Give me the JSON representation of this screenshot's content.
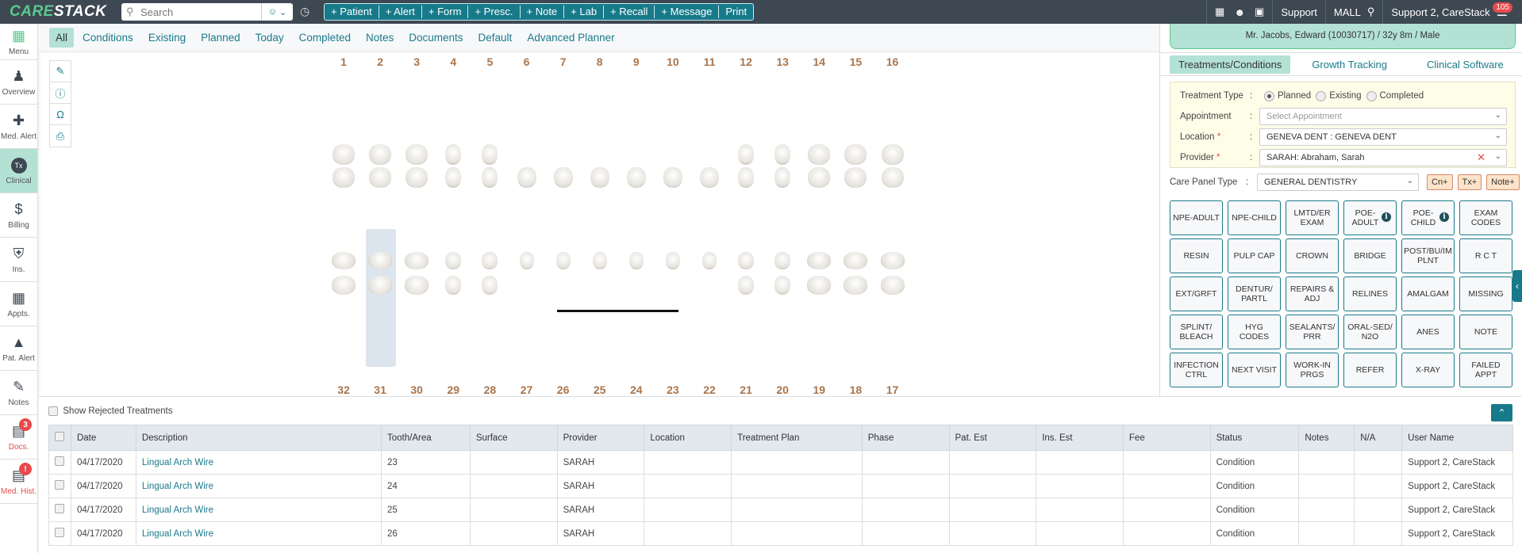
{
  "app": {
    "logo_left": "CAR",
    "logo_e": "E",
    "logo_right": "STACK"
  },
  "search": {
    "placeholder": "Search"
  },
  "quick_actions": [
    "+ Patient",
    "+ Alert",
    "+ Form",
    "+ Presc.",
    "+ Note",
    "+ Lab",
    "+ Recall",
    "+ Message",
    "Print"
  ],
  "top_right": {
    "support": "Support",
    "location": "MALL",
    "user": "Support 2, CareStack",
    "notification_count": "105"
  },
  "sidebar": {
    "items": [
      {
        "label": "Menu",
        "icon": "grid-icon"
      },
      {
        "label": "Overview",
        "icon": "person-icon"
      },
      {
        "label": "Med. Alert",
        "icon": "plus-icon"
      },
      {
        "label": "Clinical",
        "icon": "tx-icon",
        "active": true
      },
      {
        "label": "Billing",
        "icon": "dollar-doc-icon"
      },
      {
        "label": "Ins.",
        "icon": "shield-icon"
      },
      {
        "label": "Appts.",
        "icon": "calendar-icon"
      },
      {
        "label": "Pat. Alert",
        "icon": "alert-triangle-icon"
      },
      {
        "label": "Notes",
        "icon": "edit-note-icon"
      },
      {
        "label": "Docs.",
        "icon": "docs-icon",
        "badge": "3"
      },
      {
        "label": "Med. Hist.",
        "icon": "med-hist-icon",
        "badge": "!"
      }
    ]
  },
  "filters": [
    "All",
    "Conditions",
    "Existing",
    "Planned",
    "Today",
    "Completed",
    "Notes",
    "Documents",
    "Default",
    "Advanced Planner"
  ],
  "filters_active": "All",
  "tools": [
    "pencil-icon",
    "info-icon",
    "tooth-icon",
    "printer-icon"
  ],
  "chart": {
    "upper_numbers": [
      "1",
      "2",
      "3",
      "4",
      "5",
      "6",
      "7",
      "8",
      "9",
      "10",
      "11",
      "12",
      "13",
      "14",
      "15",
      "16"
    ],
    "lower_numbers": [
      "32",
      "31",
      "30",
      "29",
      "28",
      "27",
      "26",
      "25",
      "24",
      "23",
      "22",
      "21",
      "20",
      "19",
      "18",
      "17"
    ],
    "selected_tooth": "31",
    "lingual_arch_wire_teeth": [
      "26",
      "25",
      "24",
      "23"
    ]
  },
  "patient": {
    "info": "Mr. Jacobs, Edward (10030717) / 32y 8m / Male"
  },
  "right_tabs": [
    "Treatments/Conditions",
    "Growth Tracking",
    "Clinical Software"
  ],
  "form": {
    "treatment_type_label": "Treatment Type",
    "treatment_types": [
      "Planned",
      "Existing",
      "Completed"
    ],
    "treatment_type_selected": "Planned",
    "appointment_label": "Appointment",
    "appointment_placeholder": "Select Appointment",
    "location_label": "Location",
    "location_value": "GENEVA DENT : GENEVA DENT",
    "provider_label": "Provider",
    "provider_value": "SARAH: Abraham, Sarah",
    "care_panel_label": "Care Panel Type",
    "care_panel_value": "GENERAL DENTISTRY",
    "cn_btn": "Cn+",
    "tx_btn": "Tx+",
    "note_btn": "Note+"
  },
  "care_buttons": [
    {
      "label": "NPE-ADULT"
    },
    {
      "label": "NPE-CHILD"
    },
    {
      "label": "LMTD/ER EXAM"
    },
    {
      "label": "POE-ADULT",
      "info": true
    },
    {
      "label": "POE-CHILD",
      "info": true
    },
    {
      "label": "EXAM CODES"
    },
    {
      "label": "RESIN"
    },
    {
      "label": "PULP CAP"
    },
    {
      "label": "CROWN"
    },
    {
      "label": "BRIDGE"
    },
    {
      "label": "POST/BU/IM PLNT"
    },
    {
      "label": "R C T"
    },
    {
      "label": "EXT/GRFT"
    },
    {
      "label": "DENTUR/ PARTL"
    },
    {
      "label": "REPAIRS & ADJ"
    },
    {
      "label": "RELINES"
    },
    {
      "label": "AMALGAM"
    },
    {
      "label": "MISSING"
    },
    {
      "label": "SPLINT/ BLEACH"
    },
    {
      "label": "HYG CODES"
    },
    {
      "label": "SEALANTS/ PRR"
    },
    {
      "label": "ORAL-SED/ N2O"
    },
    {
      "label": "ANES"
    },
    {
      "label": "NOTE"
    },
    {
      "label": "INFECTION CTRL"
    },
    {
      "label": "NEXT VISIT"
    },
    {
      "label": "WORK-IN PRGS"
    },
    {
      "label": "REFER"
    },
    {
      "label": "X-RAY"
    },
    {
      "label": "FAILED APPT"
    }
  ],
  "bottom": {
    "show_rejected": "Show Rejected Treatments",
    "columns": [
      "Date",
      "Description",
      "Tooth/Area",
      "Surface",
      "Provider",
      "Location",
      "Treatment Plan",
      "Phase",
      "Pat. Est",
      "Ins. Est",
      "Fee",
      "Status",
      "Notes",
      "N/A",
      "User Name"
    ],
    "rows": [
      [
        "04/17/2020",
        "Lingual Arch Wire",
        "23",
        "",
        "SARAH",
        "",
        "",
        "",
        "",
        "",
        "",
        "Condition",
        "",
        "",
        "Support 2, CareStack"
      ],
      [
        "04/17/2020",
        "Lingual Arch Wire",
        "24",
        "",
        "SARAH",
        "",
        "",
        "",
        "",
        "",
        "",
        "Condition",
        "",
        "",
        "Support 2, CareStack"
      ],
      [
        "04/17/2020",
        "Lingual Arch Wire",
        "25",
        "",
        "SARAH",
        "",
        "",
        "",
        "",
        "",
        "",
        "Condition",
        "",
        "",
        "Support 2, CareStack"
      ],
      [
        "04/17/2020",
        "Lingual Arch Wire",
        "26",
        "",
        "SARAH",
        "",
        "",
        "",
        "",
        "",
        "",
        "Condition",
        "",
        "",
        "Support 2, CareStack"
      ]
    ]
  }
}
